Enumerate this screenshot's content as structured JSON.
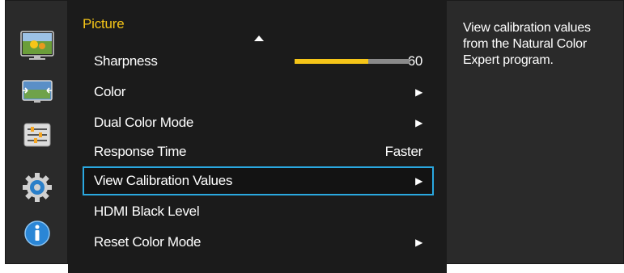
{
  "colors": {
    "accent": "#f5c518",
    "selection_border": "#2aa8e0",
    "menu_bg": "#1b1b1b",
    "panel_bg": "#2a2a2a",
    "slider_track": "#8a8a8a"
  },
  "sidebar": {
    "items": [
      {
        "icon": "picture-icon",
        "active": true
      },
      {
        "icon": "screen-size-icon",
        "active": false
      },
      {
        "icon": "settings-sliders-icon",
        "active": false
      },
      {
        "icon": "system-gear-icon",
        "active": false
      },
      {
        "icon": "information-icon",
        "active": false
      }
    ]
  },
  "menu": {
    "title": "Picture",
    "rows": [
      {
        "label": "Sharpness",
        "value": "60",
        "slider": 0.64
      },
      {
        "label": "Color",
        "arrow": "▶"
      },
      {
        "label": "Dual Color Mode",
        "arrow": "▶"
      },
      {
        "label": "Response Time",
        "value": "Faster"
      },
      {
        "label": "View Calibration Values",
        "arrow": "▶",
        "selected": true
      },
      {
        "label": "HDMI Black Level"
      },
      {
        "label": "Reset Color Mode",
        "arrow": "▶"
      }
    ]
  },
  "help": {
    "text": "View calibration values from the Natural Color Expert program."
  }
}
